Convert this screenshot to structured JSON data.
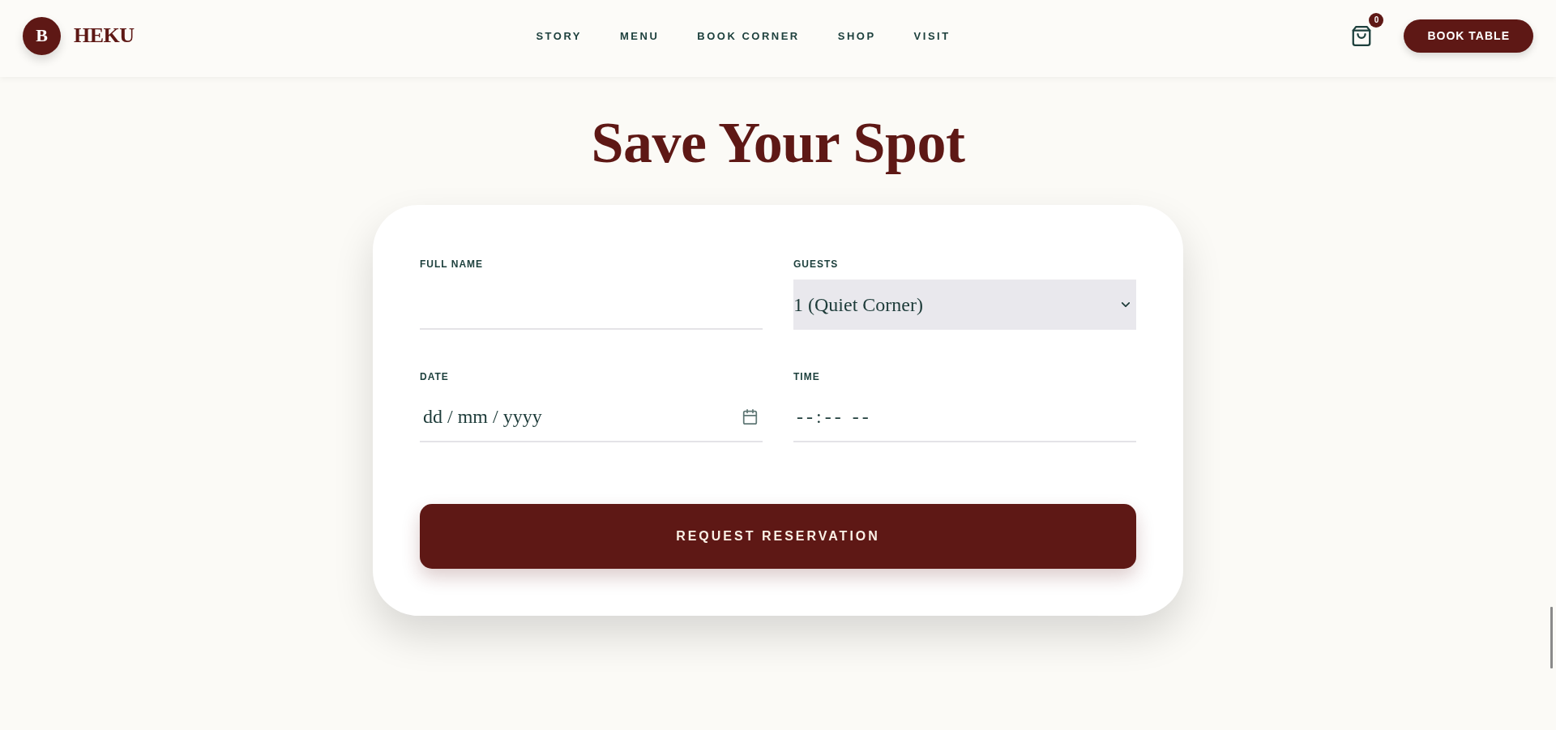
{
  "header": {
    "logo": {
      "mark": "B",
      "name": "HEKU"
    },
    "nav": [
      "STORY",
      "MENU",
      "BOOK CORNER",
      "SHOP",
      "VISIT"
    ],
    "cart": {
      "count": "0"
    },
    "action": "BOOK TABLE"
  },
  "title": "Save Your Spot",
  "form": {
    "fields": [
      {
        "kind": "text",
        "label": "FULL NAME"
      },
      {
        "kind": "select",
        "label": "GUESTS",
        "value": "1 (Quiet Corner)"
      },
      {
        "kind": "date",
        "label": "DATE",
        "placeholder": "dd / mm / yyyy"
      },
      {
        "kind": "time",
        "label": "TIME",
        "placeholder": "--:-- --"
      }
    ],
    "submit": "REQUEST RESERVATION"
  }
}
